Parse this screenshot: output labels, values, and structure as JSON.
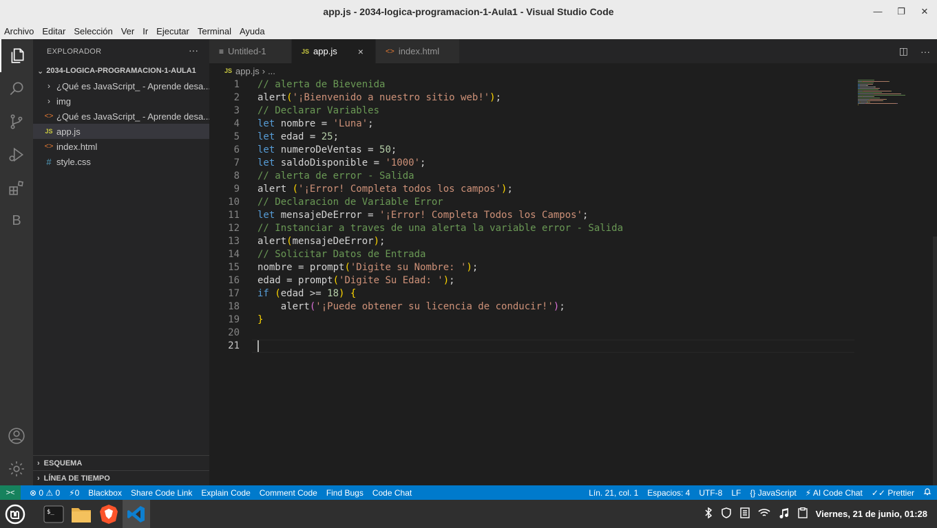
{
  "window": {
    "title": "app.js - 2034-logica-programacion-1-Aula1 - Visual Studio Code"
  },
  "menu": [
    "Archivo",
    "Editar",
    "Selección",
    "Ver",
    "Ir",
    "Ejecutar",
    "Terminal",
    "Ayuda"
  ],
  "activity": [
    "explorer-icon",
    "search-icon",
    "source-control-icon",
    "run-debug-icon",
    "extensions-icon",
    "blackbox-icon",
    "account-icon",
    "manage-gear-icon"
  ],
  "activity_letter": "B",
  "explorer": {
    "title": "EXPLORADOR",
    "more": "···",
    "folder": "2034-LOGICA-PROGRAMACION-1-AULA1",
    "items": [
      {
        "icon": "chevron-right-icon",
        "glyph": "›",
        "label": "¿Qué es JavaScript_ - Aprende desa..."
      },
      {
        "icon": "chevron-right-icon",
        "glyph": "›",
        "label": "img"
      },
      {
        "icon": "html-file-icon",
        "glyph": "<>",
        "label": "¿Qué es JavaScript_ - Aprende desa..."
      },
      {
        "icon": "js-file-icon",
        "glyph": "JS",
        "label": "app.js"
      },
      {
        "icon": "html-file-icon",
        "glyph": "<>",
        "label": "index.html"
      },
      {
        "icon": "css-file-icon",
        "glyph": "#",
        "label": "style.css"
      }
    ],
    "outline": "ESQUEMA",
    "timeline": "LÍNEA DE TIEMPO"
  },
  "tabs": [
    {
      "label": "Untitled-1",
      "icon": "≡"
    },
    {
      "label": "app.js",
      "icon": "JS",
      "close": "×"
    },
    {
      "label": "index.html",
      "icon": "<>"
    }
  ],
  "breadcrumb": {
    "icon": "JS",
    "file": "app.js",
    "sep": "›",
    "rest": "..."
  },
  "editor": {
    "lines": [
      [
        [
          "cm",
          "// alerta de Bievenida"
        ]
      ],
      [
        [
          "pun",
          "alert"
        ],
        [
          "br",
          "("
        ],
        [
          "str",
          "'¡Bienvenido a nuestro sitio web!'"
        ],
        [
          "br",
          ")"
        ],
        [
          "pun",
          ";"
        ]
      ],
      [
        [
          "cm",
          "// Declarar Variables"
        ]
      ],
      [
        [
          "kw",
          "let"
        ],
        [
          "pun",
          " nombre = "
        ],
        [
          "str",
          "'Luna'"
        ],
        [
          "pun",
          ";"
        ]
      ],
      [
        [
          "kw",
          "let"
        ],
        [
          "pun",
          " edad = "
        ],
        [
          "num",
          "25"
        ],
        [
          "pun",
          ";"
        ]
      ],
      [
        [
          "kw",
          "let"
        ],
        [
          "pun",
          " numeroDeVentas = "
        ],
        [
          "num",
          "50"
        ],
        [
          "pun",
          ";"
        ]
      ],
      [
        [
          "kw",
          "let"
        ],
        [
          "pun",
          " saldoDisponible = "
        ],
        [
          "str",
          "'1000'"
        ],
        [
          "pun",
          ";"
        ]
      ],
      [
        [
          "cm",
          "// alerta de error - Salida"
        ]
      ],
      [
        [
          "pun",
          "alert "
        ],
        [
          "br",
          "("
        ],
        [
          "str",
          "'¡Error! Completa todos los campos'"
        ],
        [
          "br",
          ")"
        ],
        [
          "pun",
          ";"
        ]
      ],
      [
        [
          "cm",
          "// Declaracion de Variable Error"
        ]
      ],
      [
        [
          "kw",
          "let"
        ],
        [
          "pun",
          " mensajeDeError = "
        ],
        [
          "str",
          "'¡Error! Completa Todos los Campos'"
        ],
        [
          "pun",
          ";"
        ]
      ],
      [
        [
          "cm",
          "// Instanciar a traves de una alerta la variable error - Salida"
        ]
      ],
      [
        [
          "pun",
          "alert"
        ],
        [
          "br",
          "("
        ],
        [
          "pun",
          "mensajeDeError"
        ],
        [
          "br",
          ")"
        ],
        [
          "pun",
          ";"
        ]
      ],
      [
        [
          "cm",
          "// Solicitar Datos de Entrada"
        ]
      ],
      [
        [
          "pun",
          "nombre = prompt"
        ],
        [
          "br",
          "("
        ],
        [
          "str",
          "'Digite su Nombre: '"
        ],
        [
          "br",
          ")"
        ],
        [
          "pun",
          ";"
        ]
      ],
      [
        [
          "pun",
          "edad = prompt"
        ],
        [
          "br",
          "("
        ],
        [
          "str",
          "'Digite Su Edad: '"
        ],
        [
          "br",
          ")"
        ],
        [
          "pun",
          ";"
        ]
      ],
      [
        [
          "kw",
          "if"
        ],
        [
          "pun",
          " "
        ],
        [
          "br",
          "("
        ],
        [
          "pun",
          "edad >= "
        ],
        [
          "num",
          "18"
        ],
        [
          "br",
          ")"
        ],
        [
          "pun",
          " "
        ],
        [
          "br",
          "{"
        ]
      ],
      [
        [
          "pun",
          "    alert"
        ],
        [
          "br2",
          "("
        ],
        [
          "str",
          "'¡Puede obtener su licencia de conducir!'"
        ],
        [
          "br2",
          ")"
        ],
        [
          "pun",
          ";"
        ]
      ],
      [
        [
          "br",
          "}"
        ]
      ],
      [],
      []
    ]
  },
  "status": {
    "remote": "><",
    "problems": "⊗ 0 ⚠ 0",
    "ports": "⚡0",
    "left_items": [
      "Blackbox",
      "Share Code Link",
      "Explain Code",
      "Comment Code",
      "Find Bugs",
      "Code Chat"
    ],
    "right_items": [
      "Lín. 21, col. 1",
      "Espacios: 4",
      "UTF-8",
      "LF",
      "{} JavaScript",
      "⚡ AI Code Chat",
      "✓✓ Prettier"
    ],
    "bell": "🔔"
  },
  "taskbar": {
    "apps": [
      "mint-menu-icon",
      "terminal-icon",
      "files-icon",
      "brave-icon",
      "vscode-icon"
    ],
    "clock": "Viernes, 21 de junio, 01:28"
  },
  "colors": {
    "accent": "#007acc",
    "remote": "#16825d",
    "comment": "#6a9955",
    "keyword": "#569cd6",
    "string": "#ce9178",
    "number": "#b5cea8"
  }
}
